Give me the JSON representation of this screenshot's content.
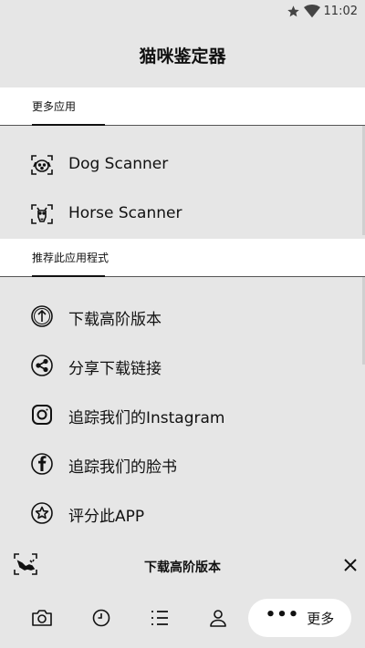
{
  "status_bar": {
    "time": "11:02",
    "icons": [
      "star-icon",
      "wifi-icon"
    ]
  },
  "app": {
    "title": "猫咪鉴定器"
  },
  "section_more_apps": {
    "header": "更多应用",
    "items": [
      {
        "label": "Dog Scanner",
        "icon": "dog-scanner-icon"
      },
      {
        "label": "Horse Scanner",
        "icon": "horse-scanner-icon"
      }
    ]
  },
  "section_recommend": {
    "header": "推荐此应用程式",
    "items": [
      {
        "label": "下载高阶版本",
        "icon": "upload-arrow-circle-icon"
      },
      {
        "label": "分享下载链接",
        "icon": "share-icon"
      },
      {
        "label": "追踪我们的Instagram",
        "icon": "instagram-icon"
      },
      {
        "label": "追踪我们的脸书",
        "icon": "facebook-icon"
      },
      {
        "label": "评分此APP",
        "icon": "star-circle-icon"
      }
    ]
  },
  "banner": {
    "text": "下载高阶版本"
  },
  "bottom_nav": {
    "items": [
      "camera-icon",
      "history-clock-icon",
      "list-icon",
      "profile-icon"
    ],
    "more_dots": "•••",
    "more_label": "更多"
  }
}
